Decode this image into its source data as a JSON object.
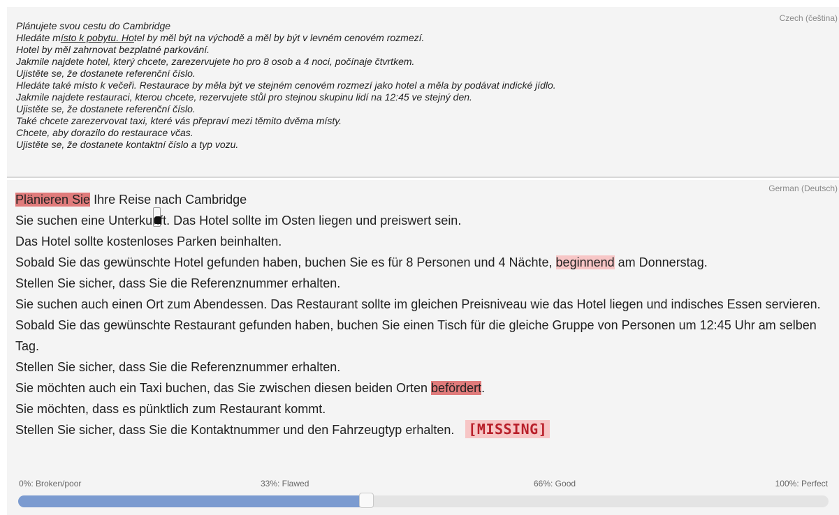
{
  "source": {
    "language": "Czech (čeština)",
    "lines": [
      "Plánujete svou cestu do Cambridge",
      [
        "Hledáte m",
        "ísto k pobytu. Ho",
        "tel by měl být na východě a měl by být v levném cenovém rozmezí."
      ],
      "Hotel by měl zahrnovat bezplatné parkování.",
      "Jakmile najdete hotel, který chcete, zarezervujete ho pro 8 osob a 4 noci, počínaje čtvrtkem.",
      "Ujistěte se, že dostanete referenční číslo.",
      "Hledáte také místo k večeři. Restaurace by měla být ve stejném cenovém rozmezí jako hotel a měla by podávat indické jídlo.",
      "Jakmile najdete restauraci, kterou chcete, rezervujete stůl pro stejnou skupinu lidí na 12:45 ve stejný den.",
      "Ujistěte se, že dostanete referenční číslo.",
      "Také chcete zarezervovat taxi, které vás přepraví mezi těmito dvěma místy.",
      "Chcete, aby dorazilo do restaurace včas.",
      "Ujistěte se, že dostanete kontaktní číslo a typ vozu."
    ]
  },
  "target": {
    "language": "German (Deutsch)",
    "line1": {
      "highlight": "Plänieren Sie",
      "rest": " Ihre Reise nach Cambridge"
    },
    "line2": "Sie suchen eine Unterkunft. Das Hotel sollte im Osten liegen und preiswert sein.",
    "line3": "Das Hotel sollte kostenloses Parken beinhalten.",
    "line4": {
      "before": "Sobald Sie das gewünschte Hotel gefunden haben, buchen Sie es für 8 Personen und 4 Nächte, ",
      "highlight": "beginnend",
      "after": " am Donnerstag."
    },
    "line5": "Stellen Sie sicher, dass Sie die Referenznummer erhalten.",
    "line6": "Sie suchen auch einen Ort zum Abendessen. Das Restaurant sollte im gleichen Preisniveau wie das Hotel liegen und indisches Essen servieren.",
    "line7": "Sobald Sie das gewünschte Restaurant gefunden haben, buchen Sie einen Tisch für die gleiche Gruppe von Personen um 12:45 Uhr am selben Tag.",
    "line8": "Stellen Sie sicher, dass Sie die Referenznummer erhalten.",
    "line9": {
      "before": "Sie möchten auch ein Taxi buchen, das Sie zwischen diesen beiden Orten ",
      "highlight": "befördert",
      "after": "."
    },
    "line10": "Sie möchten, dass es pünktlich zum Restaurant kommt.",
    "line11": {
      "text": "Stellen Sie sicher, dass Sie die Kontaktnummer und den Fahrzeugtyp erhalten.",
      "missing": "[MISSING]"
    }
  },
  "scale": {
    "labels": [
      "0%: Broken/poor",
      "33%: Flawed",
      "66%: Good",
      "100%: Perfect"
    ],
    "value_fraction": 0.43
  },
  "colors": {
    "highlight_strong": "#e07b7b",
    "highlight_light": "#f7c6c6",
    "slider_fill": "#7b9bd0"
  }
}
